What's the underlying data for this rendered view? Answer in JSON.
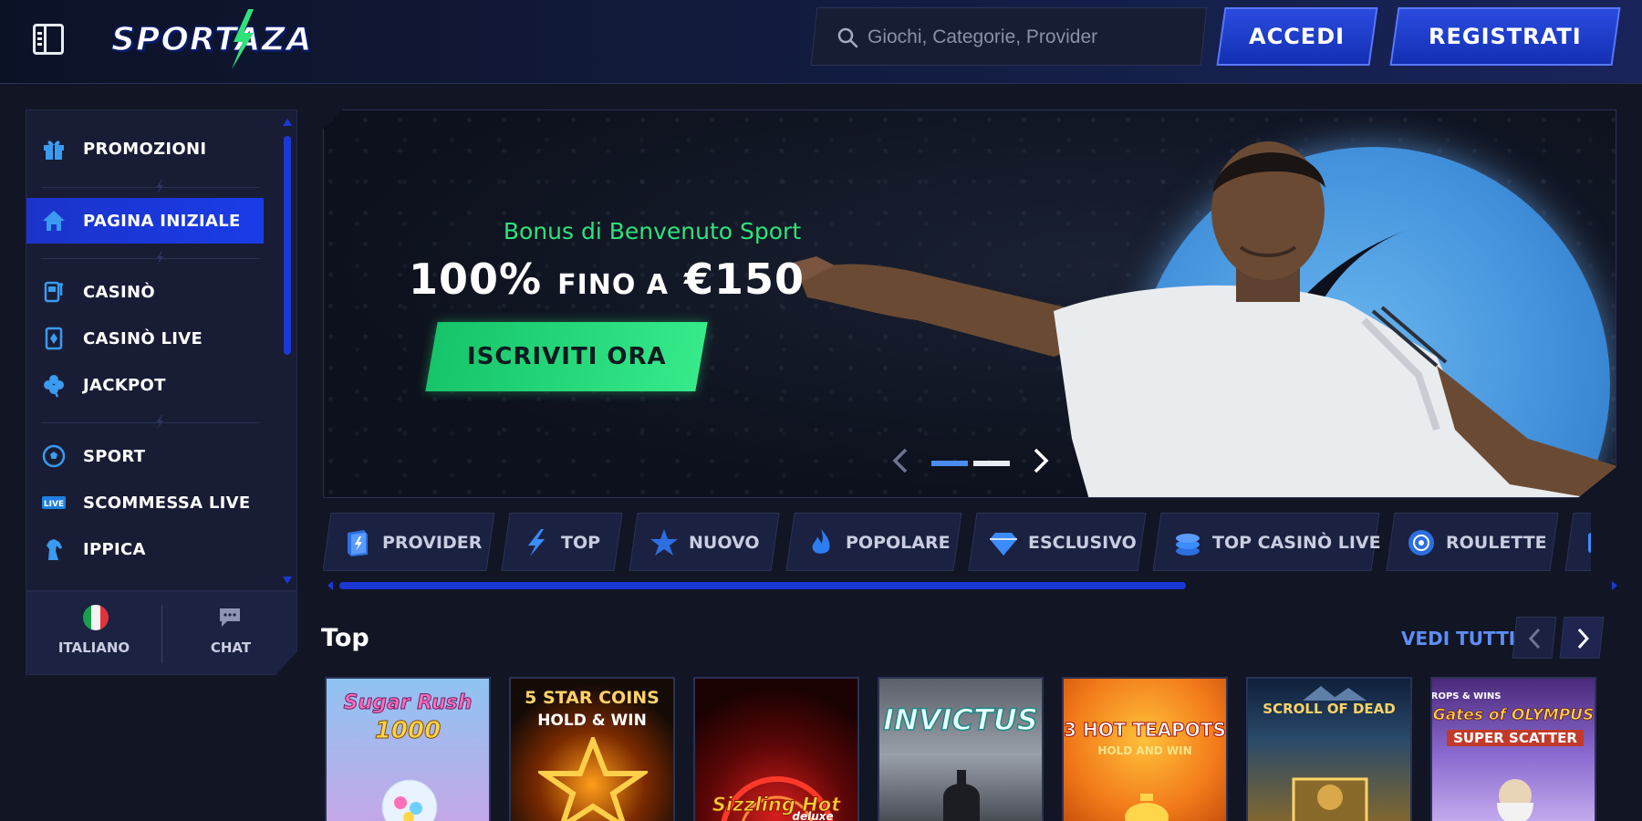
{
  "header": {
    "logo_text": "SPORTAZA",
    "search": {
      "placeholder": "Giochi, Categorie, Provider"
    },
    "login_label": "ACCEDI",
    "register_label": "REGISTRATI"
  },
  "sidebar": {
    "items": [
      {
        "label": "PROMOZIONI",
        "icon": "gift-icon"
      },
      {
        "label": "PAGINA INIZIALE",
        "icon": "home-icon",
        "active": true
      },
      {
        "label": "CASINÒ",
        "icon": "slot-machine-icon"
      },
      {
        "label": "CASINÒ LIVE",
        "icon": "card-diamond-icon"
      },
      {
        "label": "JACKPOT",
        "icon": "clover-icon"
      },
      {
        "label": "SPORT",
        "icon": "soccer-ball-icon"
      },
      {
        "label": "SCOMMESSA LIVE",
        "icon": "live-badge-icon"
      },
      {
        "label": "IPPICA",
        "icon": "horse-icon"
      }
    ],
    "footer": {
      "language_label": "ITALIANO",
      "chat_label": "CHAT"
    }
  },
  "hero": {
    "subtitle": "Bonus di Benvenuto Sport",
    "title_main": "100%",
    "title_mid": "FINO A",
    "title_amount": "€150",
    "cta_label": "ISCRIVITI ORA",
    "slides_total": 2,
    "active_slide": 1
  },
  "categories": [
    {
      "label": "PROVIDER",
      "icon": "book-icon"
    },
    {
      "label": "TOP",
      "icon": "lightning-icon"
    },
    {
      "label": "NUOVO",
      "icon": "star-icon"
    },
    {
      "label": "POPOLARE",
      "icon": "flame-icon"
    },
    {
      "label": "ESCLUSIVO",
      "icon": "diamond-icon"
    },
    {
      "label": "TOP CASINÒ LIVE",
      "icon": "chips-icon"
    },
    {
      "label": "ROULETTE",
      "icon": "roulette-icon"
    }
  ],
  "top_section": {
    "title": "Top",
    "see_all_label": "VEDI TUTTI",
    "games": [
      {
        "name": "Sugar Rush 1000",
        "line1": "Sugar Rush",
        "line2": "1000"
      },
      {
        "name": "5 Star Coins Hold & Win",
        "line1": "5 STAR COINS",
        "line2": "HOLD & WIN"
      },
      {
        "name": "Sizzling Hot Deluxe",
        "line1": "Sizzling Hot",
        "line2": "deluxe"
      },
      {
        "name": "Invictus",
        "line1": "INVICTUS",
        "line2": ""
      },
      {
        "name": "3 Hot Teapots Hold and Win",
        "line1": "3 HOT TEAPOTS",
        "line2": "HOLD AND WIN"
      },
      {
        "name": "Scroll of Dead",
        "line1": "SCROLL OF DEAD",
        "line2": ""
      },
      {
        "name": "Gates of Olympus Super Scatter",
        "line1": "Gates of OLYMPUS",
        "line2": "SUPER SCATTER",
        "badge": "DROPS & WINS"
      }
    ]
  },
  "colors": {
    "background": "#111524",
    "accent_blue": "#1b38d6",
    "accent_green": "#2fe37a",
    "link_blue": "#5e8ef5"
  }
}
